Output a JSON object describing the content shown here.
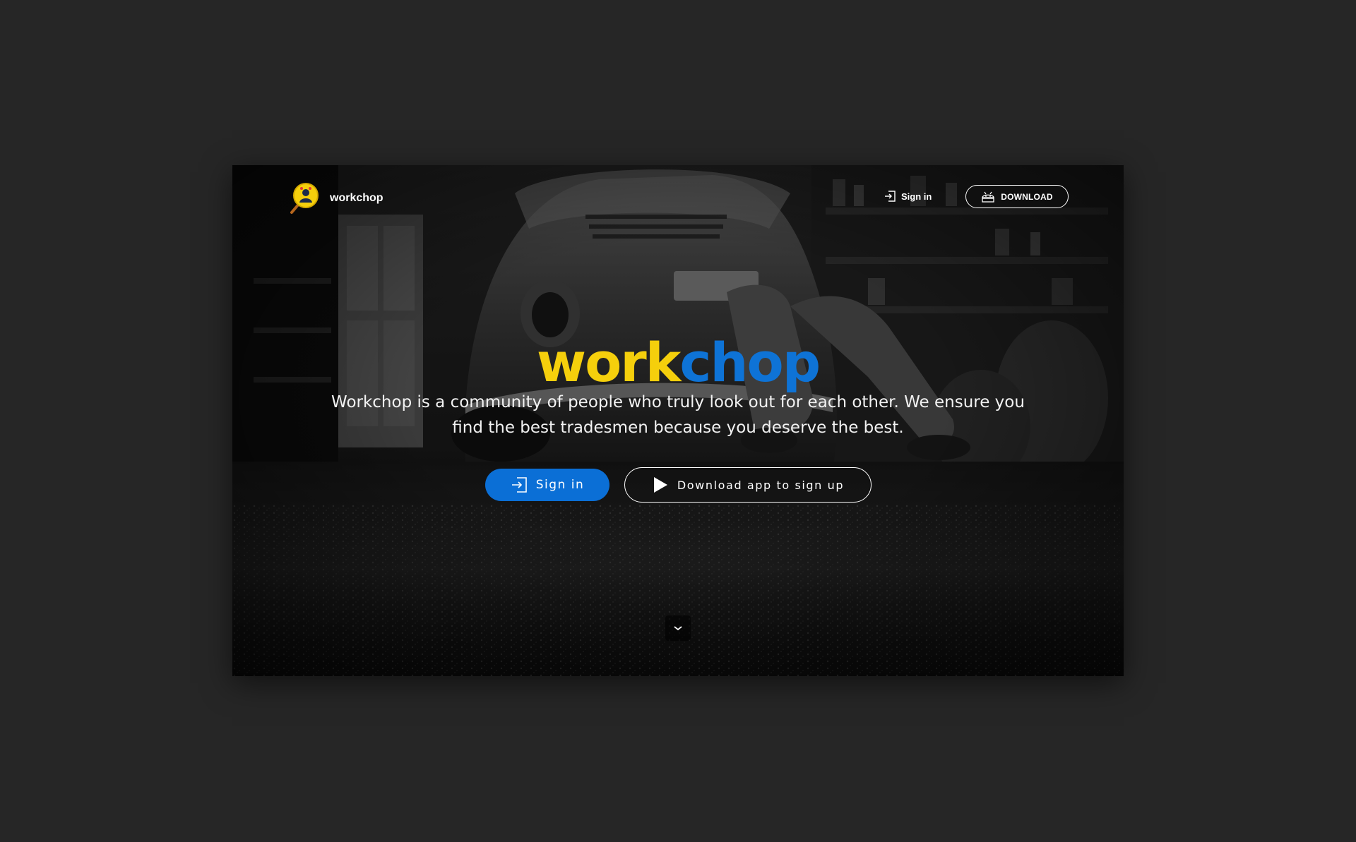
{
  "nav": {
    "brand_name": "workchop",
    "signin_label": "Sign in",
    "download_label": "DOWNLOAD",
    "icons": [
      "magnifier-logo-icon",
      "sign-in-icon",
      "android-icon"
    ]
  },
  "hero": {
    "logo_part1": "work",
    "logo_part2": "chop",
    "description": "Workchop is a community of people who truly look out for each other. We ensure you find the best tradesmen because you deserve the best.",
    "signin_label": "Sign in",
    "download_label": "Download app to sign up",
    "icons": [
      "sign-in-icon",
      "play-icon",
      "chevron-down-icon"
    ]
  },
  "colors": {
    "page_bg": "#262626",
    "brand_yellow": "#f5cf0c",
    "brand_blue": "#0e73d6",
    "button_blue": "#0b6fd6"
  }
}
